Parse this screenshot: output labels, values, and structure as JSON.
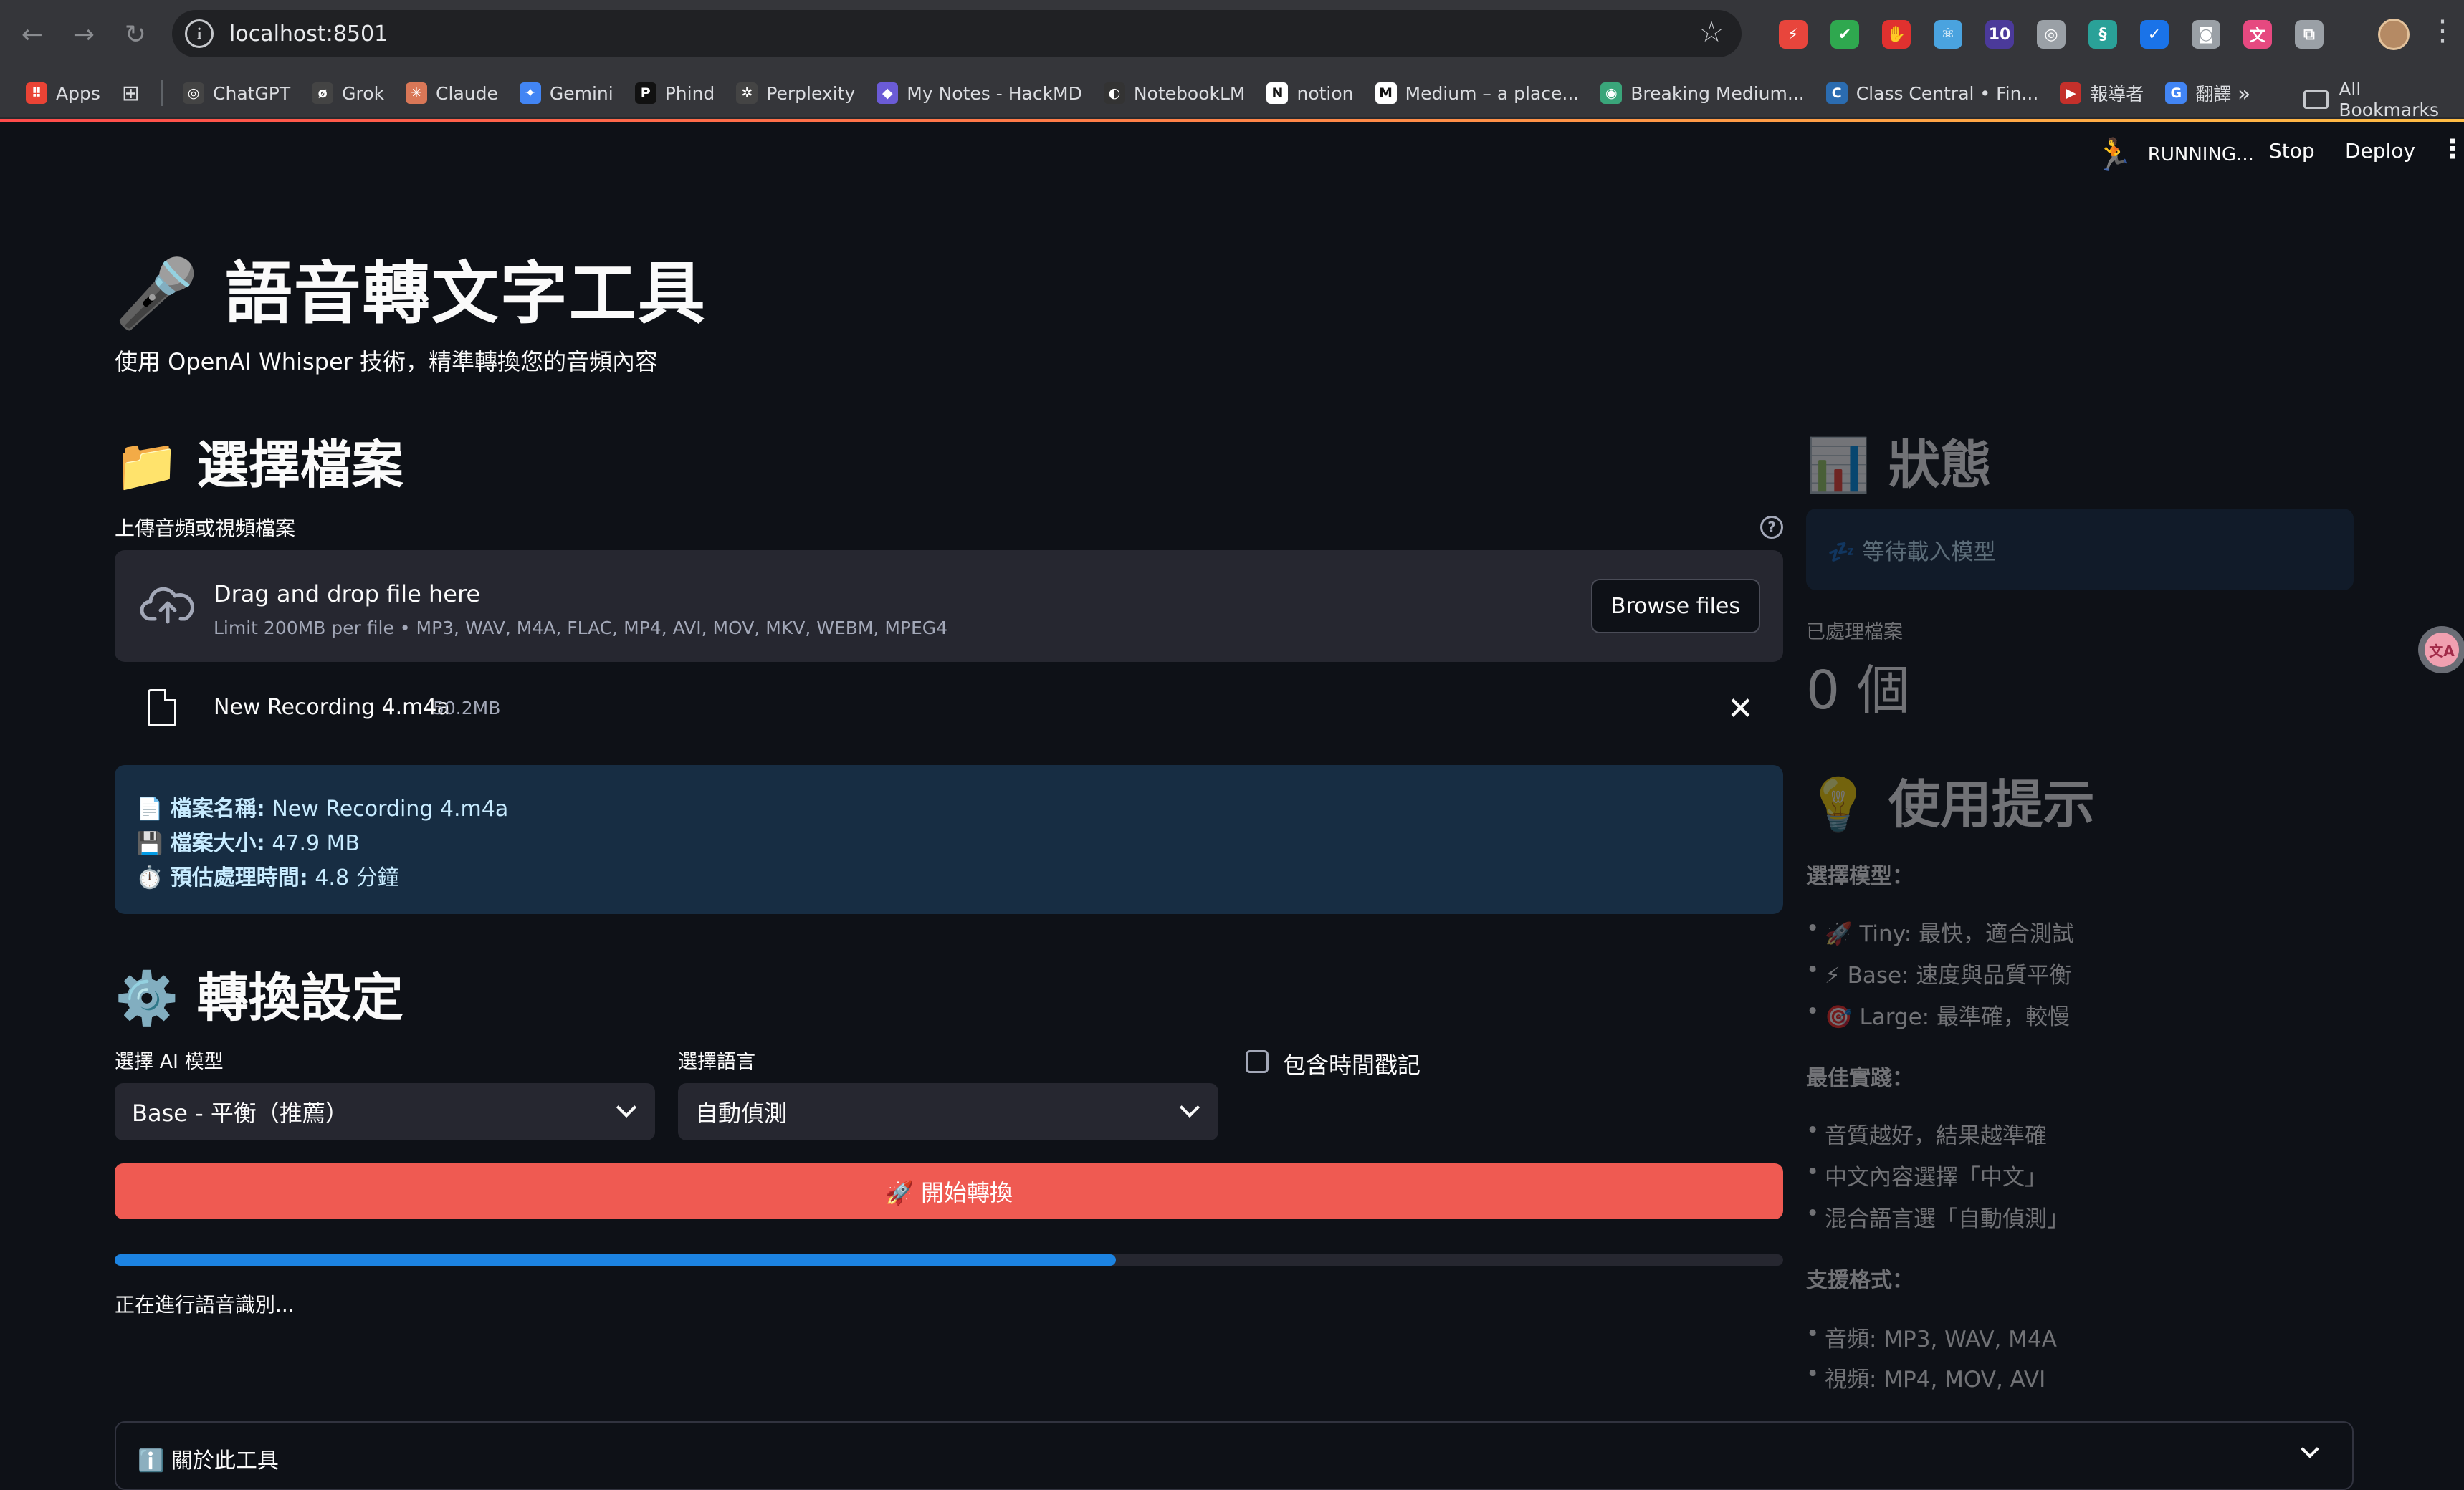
{
  "browser": {
    "url": "localhost:8501",
    "extensions": [
      {
        "name": "lightning-ext-icon",
        "color": "#e8453c",
        "glyph": "⚡"
      },
      {
        "name": "shield-ext-icon",
        "color": "#2fa84f",
        "glyph": "✔"
      },
      {
        "name": "hand-ext-icon",
        "color": "#e0312f",
        "glyph": "✋"
      },
      {
        "name": "react-ext-icon",
        "color": "#4aa3df",
        "glyph": "⚛"
      },
      {
        "name": "badge-ext-icon",
        "color": "#4b3a9a",
        "glyph": "10"
      },
      {
        "name": "target-ext-icon",
        "color": "#9aa0a6",
        "glyph": "◎"
      },
      {
        "name": "tag-ext-icon",
        "color": "#2aa198",
        "glyph": "§"
      },
      {
        "name": "check-ext-icon",
        "color": "#1a73e8",
        "glyph": "✓"
      },
      {
        "name": "camera-ext-icon",
        "color": "#9aa0a6",
        "glyph": "◙"
      },
      {
        "name": "translate-ext-icon",
        "color": "#e64980",
        "glyph": "文"
      },
      {
        "name": "puzzle-ext-icon",
        "color": "#9aa0a6",
        "glyph": "⧉"
      }
    ]
  },
  "bookmarks": [
    {
      "label": "Apps",
      "icon": "apps-grid-icon",
      "color": "#ea4335",
      "glyph": "⠿"
    },
    {
      "label": "ChatGPT",
      "icon": "chatgpt-icon",
      "color": "#444",
      "glyph": "◎"
    },
    {
      "label": "Grok",
      "icon": "grok-icon",
      "color": "#444",
      "glyph": "ø"
    },
    {
      "label": "Claude",
      "icon": "claude-icon",
      "color": "#d97757",
      "glyph": "✳"
    },
    {
      "label": "Gemini",
      "icon": "gemini-icon",
      "color": "#4285f4",
      "glyph": "✦"
    },
    {
      "label": "Phind",
      "icon": "phind-icon",
      "color": "#111",
      "glyph": "P"
    },
    {
      "label": "Perplexity",
      "icon": "perplexity-icon",
      "color": "#444",
      "glyph": "✲"
    },
    {
      "label": "My Notes - HackMD",
      "icon": "hackmd-icon",
      "color": "#6b5bd6",
      "glyph": "◆"
    },
    {
      "label": "NotebookLM",
      "icon": "notebooklm-icon",
      "color": "#333",
      "glyph": "◐"
    },
    {
      "label": "notion",
      "icon": "notion-icon",
      "color": "#fff",
      "glyph": "N"
    },
    {
      "label": "Medium – a place...",
      "icon": "medium-icon",
      "color": "#fff",
      "glyph": "M"
    },
    {
      "label": "Breaking Medium...",
      "icon": "breaking-medium-icon",
      "color": "#3aa57a",
      "glyph": "◉"
    },
    {
      "label": "Class Central • Fin...",
      "icon": "classcentral-icon",
      "color": "#2b6cb0",
      "glyph": "C"
    },
    {
      "label": "報導者",
      "icon": "twreporter-icon",
      "color": "#c4302b",
      "glyph": "▶"
    },
    {
      "label": "翻譯",
      "icon": "translate-bookmark-icon",
      "color": "#4285f4",
      "glyph": "G"
    }
  ],
  "bookmarks_all": "All Bookmarks",
  "app_header": {
    "running": "RUNNING...",
    "stop": "Stop",
    "deploy": "Deploy"
  },
  "main": {
    "title": "🎤 語音轉文字工具",
    "subtitle": "使用 OpenAI Whisper 技術，精準轉換您的音頻內容",
    "select_heading": "📁 選擇檔案",
    "upload_label": "上傳音頻或視頻檔案",
    "dropzone_title": "Drag and drop file here",
    "dropzone_limit": "Limit 200MB per file • MP3, WAV, M4A, FLAC, MP4, AVI, MOV, MKV, WEBM, MPEG4",
    "browse_label": "Browse files",
    "file_name": "New Recording 4.m4a",
    "file_size": "50.2MB",
    "info": {
      "name_label": "📄 檔案名稱:",
      "name_value": " New Recording 4.m4a",
      "size_label": "💾 檔案大小:",
      "size_value": " 47.9 MB",
      "time_label": "⏱️ 預估處理時間:",
      "time_value": " 4.8 分鐘"
    },
    "settings_heading": "⚙️ 轉換設定",
    "model_label": "選擇 AI 模型",
    "model_value": "Base - 平衡（推薦）",
    "language_label": "選擇語言",
    "language_value": "自動偵測",
    "timestamp_label": "包含時間戳記",
    "start_label": "🚀 開始轉換",
    "progress": 0.6,
    "progress_text": "正在進行語音識別...",
    "about_label": "ℹ️ 關於此工具"
  },
  "sidebar": {
    "status_heading": "📊 狀態",
    "status_message": "💤 等待載入模型",
    "processed_label": "已處理檔案",
    "processed_value": "0 個",
    "tips_heading": "💡 使用提示",
    "model_head": "選擇模型：",
    "model_tips": [
      "🚀 Tiny: 最快，適合測試",
      "⚡ Base: 速度與品質平衡",
      "🎯 Large: 最準確，較慢"
    ],
    "best_head": "最佳實踐：",
    "best_tips": [
      "音質越好，結果越準確",
      "中文內容選擇「中文」",
      "混合語言選「自動偵測」"
    ],
    "format_head": "支援格式：",
    "format_tips": [
      "音頻: MP3, WAV, M4A",
      "視頻: MP4, MOV, AVI"
    ]
  }
}
